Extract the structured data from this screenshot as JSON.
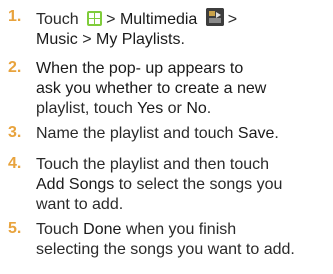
{
  "steps": [
    {
      "number": "1.",
      "line1": {
        "pre": "Touch",
        "after_grid": ">",
        "multimedia": "Multimedia",
        "gt": ">"
      },
      "line2": {
        "music": "Music",
        "sep": ">",
        "playlists": "My Playlists",
        "period": "."
      }
    },
    {
      "number": "2.",
      "lines": [
        "When the pop- up appears to",
        "ask you whether to create a new"
      ],
      "line3": {
        "pre": "playlist, touch",
        "yes": "Yes",
        "or": "or",
        "no": "No",
        "period": "."
      }
    },
    {
      "number": "3.",
      "line1": {
        "pre": "Name the playlist and touch",
        "save": "Save",
        "period": "."
      }
    },
    {
      "number": "4.",
      "line1": {
        "pre": "Touch the playlist and then touch"
      },
      "line2": {
        "add_songs": "Add Songs",
        "post": "to select the songs you"
      },
      "line3": {
        "text": "want to add."
      }
    },
    {
      "number": "5.",
      "line1": {
        "pre": "Touch",
        "done": "Done",
        "post": "when you finish"
      },
      "line2": {
        "text": "selecting the songs you want to add."
      }
    }
  ],
  "icons": {
    "grid": "apps-grid-icon",
    "multimedia": "multimedia-icon"
  },
  "colors": {
    "number": "#e8a33d",
    "grid_icon": "#7fcc3b",
    "multimedia_icon": "#3d3d3d"
  }
}
